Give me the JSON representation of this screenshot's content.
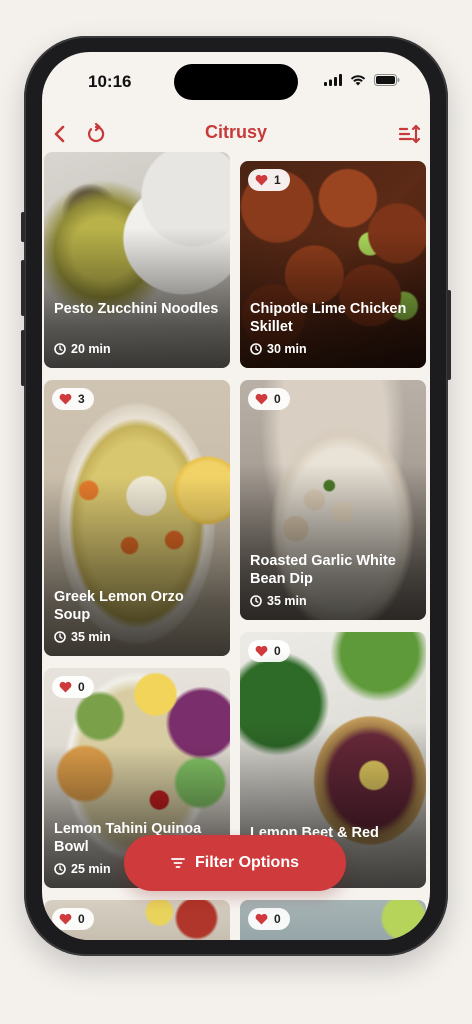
{
  "status_bar": {
    "time": "10:16"
  },
  "nav": {
    "title": "Citrusy",
    "back_icon": "chevron-left-icon",
    "refresh_icon": "refresh-icon",
    "sort_icon": "sort-icon"
  },
  "recipes": [
    {
      "title": "Pesto Zucchini Noodles",
      "time": "20 min",
      "likes": null
    },
    {
      "title": "Chipotle Lime Chicken Skillet",
      "time": "30 min",
      "likes": "1"
    },
    {
      "title": "Greek Lemon Orzo Soup",
      "time": "35 min",
      "likes": "3"
    },
    {
      "title": "Roasted Garlic White Bean Dip",
      "time": "35 min",
      "likes": "0"
    },
    {
      "title": "Lemon Tahini Quinoa Bowl",
      "time": "25 min",
      "likes": "0"
    },
    {
      "title": "Lemon Beet & Red",
      "time": "",
      "likes": "0"
    },
    {
      "title": "",
      "time": "",
      "likes": "0"
    },
    {
      "title": "",
      "time": "",
      "likes": "0"
    }
  ],
  "filter_button": {
    "label": "Filter Options"
  },
  "colors": {
    "accent": "#cf3a3c",
    "title": "#c83a3a",
    "background": "#f6f3ef"
  }
}
